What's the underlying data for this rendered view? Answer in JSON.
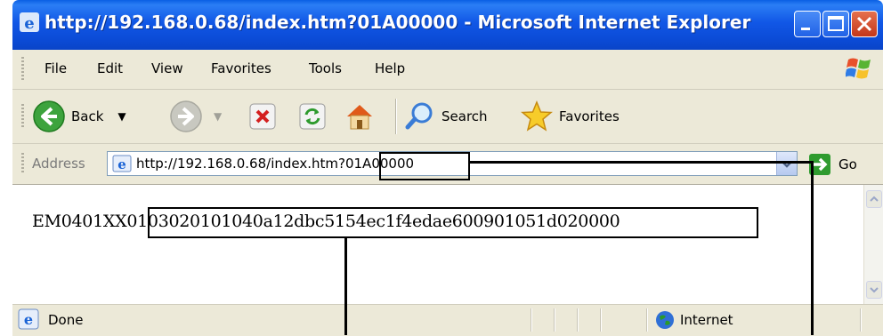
{
  "window": {
    "title": "http://192.168.0.68/index.htm?01A00000 - Microsoft Internet Explorer"
  },
  "menu": {
    "items": [
      "File",
      "Edit",
      "View",
      "Favorites",
      "Tools",
      "Help"
    ]
  },
  "toolbar": {
    "back_label": "Back",
    "search_label": "Search",
    "favorites_label": "Favorites"
  },
  "address": {
    "label": "Address",
    "url": "http://192.168.0.68/index.htm?01A00000",
    "go_label": "Go"
  },
  "content": {
    "text": "EM0401XX0103020101040a12dbc5154ec1f4edae600901051d020000"
  },
  "status": {
    "text": "Done",
    "zone": "Internet"
  },
  "colors": {
    "titlebar": "#0b4bd6",
    "chrome": "#ece9d8",
    "close": "#c3371a",
    "go": "#2f9b2f"
  }
}
